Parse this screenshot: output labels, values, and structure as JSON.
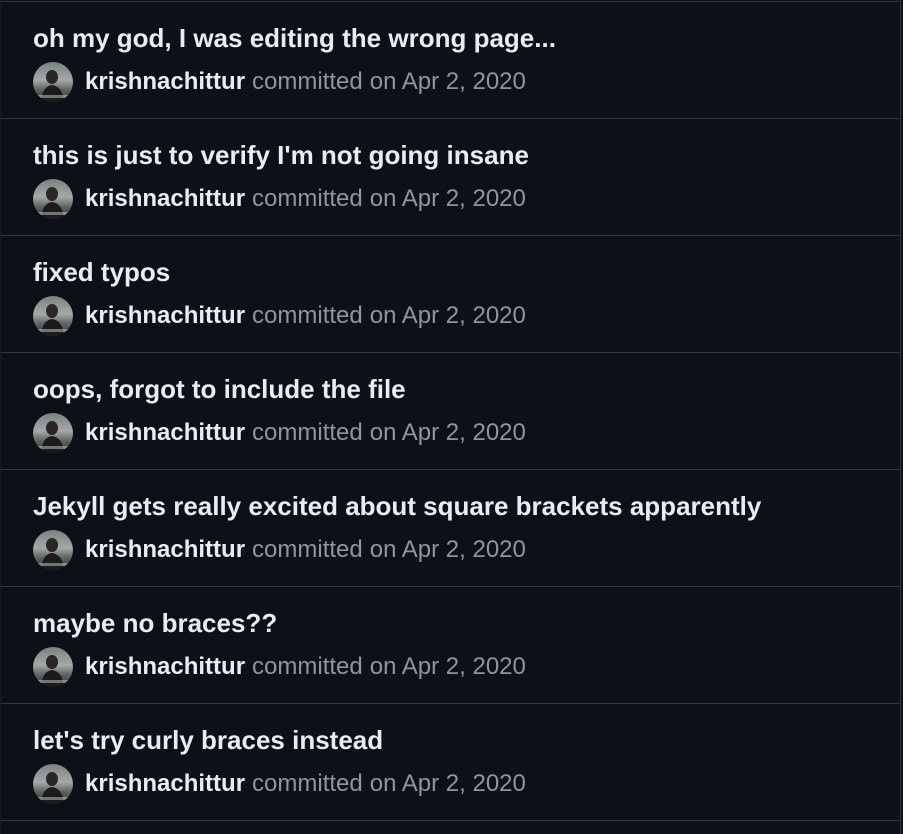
{
  "commits": [
    {
      "message": "oh my god, I was editing the wrong page...",
      "author": "krishnachittur",
      "action": "committed",
      "date": "on Apr 2, 2020"
    },
    {
      "message": "this is just to verify I'm not going insane",
      "author": "krishnachittur",
      "action": "committed",
      "date": "on Apr 2, 2020"
    },
    {
      "message": "fixed typos",
      "author": "krishnachittur",
      "action": "committed",
      "date": "on Apr 2, 2020"
    },
    {
      "message": "oops, forgot to include the file",
      "author": "krishnachittur",
      "action": "committed",
      "date": "on Apr 2, 2020"
    },
    {
      "message": "Jekyll gets really excited about square brackets apparently",
      "author": "krishnachittur",
      "action": "committed",
      "date": "on Apr 2, 2020"
    },
    {
      "message": "maybe no braces??",
      "author": "krishnachittur",
      "action": "committed",
      "date": "on Apr 2, 2020"
    },
    {
      "message": "let's try curly braces instead",
      "author": "krishnachittur",
      "action": "committed",
      "date": "on Apr 2, 2020"
    }
  ]
}
